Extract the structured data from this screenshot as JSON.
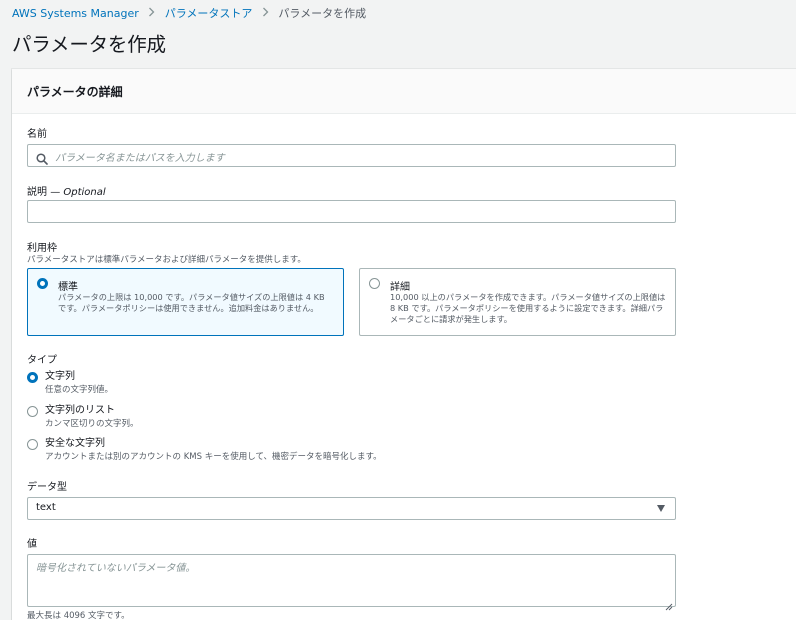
{
  "breadcrumb": {
    "items": [
      "AWS Systems Manager",
      "パラメータストア"
    ],
    "current": "パラメータを作成",
    "separator": ">"
  },
  "page": {
    "title": "パラメータを作成"
  },
  "panel": {
    "title": "パラメータの詳細"
  },
  "name_field": {
    "label": "名前",
    "placeholder": "パラメータ名またはパスを入力します",
    "value": ""
  },
  "description_field": {
    "label": "説明",
    "optional": "Optional",
    "dash": "—",
    "value": ""
  },
  "tier": {
    "label": "利用枠",
    "description": "パラメータストアは標準パラメータおよび詳細パラメータを提供します。",
    "options": [
      {
        "title": "標準",
        "description": "パラメータの上限は 10,000 です。パラメータ値サイズの上限値は 4 KB です。パラメータポリシーは使用できません。追加料金はありません。",
        "selected": true
      },
      {
        "title": "詳細",
        "description": "10,000 以上のパラメータを作成できます。パラメータ値サイズの上限値は 8 KB です。パラメータポリシーを使用するように設定できます。詳細パラメータごとに請求が発生します。",
        "selected": false
      }
    ]
  },
  "type": {
    "label": "タイプ",
    "options": [
      {
        "label": "文字列",
        "description": "任意の文字列値。",
        "selected": true
      },
      {
        "label": "文字列のリスト",
        "description": "カンマ区切りの文字列。",
        "selected": false
      },
      {
        "label": "安全な文字列",
        "description": "アカウントまたは別のアカウントの KMS キーを使用して、機密データを暗号化します。",
        "selected": false
      }
    ]
  },
  "data_type": {
    "label": "データ型",
    "selected": "text"
  },
  "value_field": {
    "label": "値",
    "placeholder": "暗号化されていないパラメータ値。",
    "value": "",
    "constraint": "最大長は 4096 文字です。"
  },
  "colors": {
    "link": "#0073bb",
    "selected_tile_bg": "#f1faff",
    "text": "#16191f",
    "secondary_text": "#545b64",
    "border": "#aab7b8",
    "page_bg": "#f2f3f3"
  }
}
